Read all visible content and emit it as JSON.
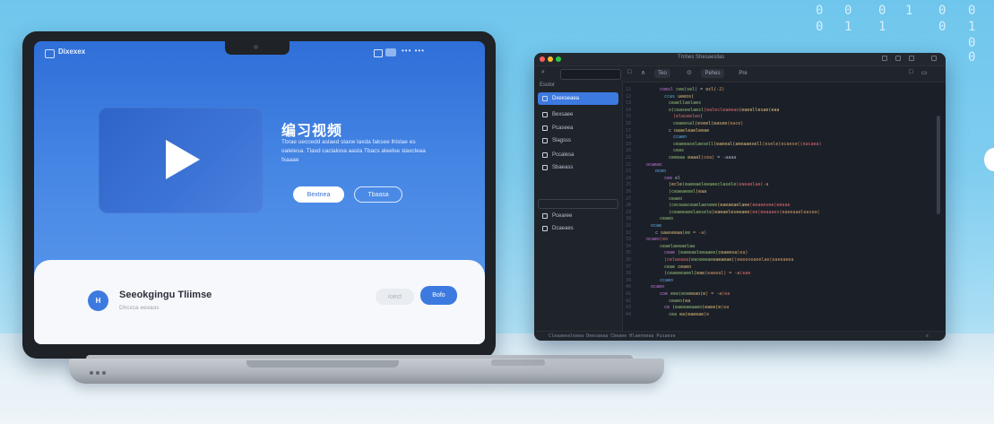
{
  "binary_digits": [
    "0",
    "0",
    "0",
    "1",
    "0",
    "0",
    "0",
    "1",
    "1",
    "0",
    "1",
    "0",
    "0"
  ],
  "laptop": {
    "brand": "Dixexex",
    "topbar_dots": "••• •••",
    "hero": {
      "title": "编习视频",
      "description": "Tbrae ueccedd aslaed slaxw laxda faksee lhlslae es oalelesa. Tlaxd caclalooa aasla Tbacs aleelse slaxcleaa fxaaae",
      "btn_primary": "Bextnea",
      "btn_outline": "Tbaasa"
    },
    "bottom": {
      "avatar": "H",
      "title": "Seeokgingu Tliimse",
      "subtitle": "Dhcxca eexaos",
      "btn_light": "Ioect",
      "btn_blue": "Bofo"
    }
  },
  "editor": {
    "title": "Tmhes Shesaesllas",
    "tools": {
      "search_icon": "search-icon",
      "pill1": "Teo",
      "pill2": "Pehes",
      "pill3": "Pre"
    },
    "sidebar": {
      "header": "Esolor",
      "items": [
        {
          "label": "Dxexseaea",
          "icon": "file-icon",
          "active": true
        },
        {
          "label": "Bexsaee",
          "icon": "folder-icon",
          "active": false
        },
        {
          "label": "Pcaseea",
          "icon": "settings-icon",
          "active": false
        },
        {
          "label": "Slagsss",
          "icon": "layers-icon",
          "active": false
        },
        {
          "label": "Pccalesa",
          "icon": "document-icon",
          "active": false
        },
        {
          "label": "Sbaeass",
          "icon": "gear-icon",
          "active": false
        },
        {
          "label": "Pcearee",
          "icon": "box-icon",
          "active": false
        },
        {
          "label": "Dcaeaes",
          "icon": "database-icon",
          "active": false
        }
      ]
    },
    "code_lines": [
      {
        "n": "11",
        "indent": 4,
        "segs": [
          {
            "t": "coesl ",
            "c": "#c678dd"
          },
          {
            "t": "cee(sel",
            "c": "#98c379"
          },
          {
            "t": ") = ",
            "c": "#abb2bf"
          },
          {
            "t": "ocl(",
            "c": "#e5c07b"
          },
          {
            "t": "-2)",
            "c": "#d19a66"
          }
        ]
      },
      {
        "n": "12",
        "indent": 5,
        "segs": [
          {
            "t": "ccas ",
            "c": "#56b6c2"
          },
          {
            "t": "ueeos(",
            "c": "#e5c07b"
          }
        ]
      },
      {
        "n": "13",
        "indent": 6,
        "segs": [
          {
            "t": "ceaellaelaes",
            "c": "#98c379"
          }
        ]
      },
      {
        "n": "14",
        "indent": 6,
        "segs": [
          {
            "t": "o(ceaseelaesl",
            "c": "#98c379"
          },
          {
            "t": "(ealecleaeeao",
            "c": "#e06c75"
          },
          {
            "t": "(eaeellesae(eaa",
            "c": "#e5c07b"
          }
        ]
      },
      {
        "n": "15",
        "indent": 7,
        "segs": [
          {
            "t": "(elaceeleo",
            "c": "#e06c75"
          },
          {
            "t": "(",
            "c": "#abb2bf"
          }
        ]
      },
      {
        "n": "16",
        "indent": 7,
        "segs": [
          {
            "t": "ceaeesal",
            "c": "#98c379"
          },
          {
            "t": "(eseel(easee",
            "c": "#e5c07b"
          },
          {
            "t": "(eace)",
            "c": "#d19a66"
          }
        ]
      },
      {
        "n": "17",
        "indent": 6,
        "segs": [
          {
            "t": "c ",
            "c": "#abb2bf"
          },
          {
            "t": "oaaeleaeleeae",
            "c": "#e5c07b"
          }
        ]
      },
      {
        "n": "18",
        "indent": 7,
        "segs": [
          {
            "t": "ccaen",
            "c": "#61afef"
          }
        ]
      },
      {
        "n": "19",
        "indent": 7,
        "segs": [
          {
            "t": "ceaeeaselaesell",
            "c": "#98c379"
          },
          {
            "t": "(eaeeal(aeeaaesell",
            "c": "#e5c07b"
          },
          {
            "t": "(esele(ecaese(",
            "c": "#d19a66"
          },
          {
            "t": "(eacaea)",
            "c": "#e06c75"
          }
        ]
      },
      {
        "n": "20",
        "indent": 7,
        "segs": [
          {
            "t": "ceas",
            "c": "#98c379"
          }
        ]
      },
      {
        "n": "21",
        "indent": 6,
        "segs": [
          {
            "t": "ceeeaa ",
            "c": "#98c379"
          },
          {
            "t": "eaaal",
            "c": "#e5c07b"
          },
          {
            "t": "(cea) ",
            "c": "#d19a66"
          },
          {
            "t": "= -aaaa",
            "c": "#abb2bf"
          }
        ]
      },
      {
        "n": "22",
        "indent": 1,
        "segs": [
          {
            "t": "ocaeac",
            "c": "#c678dd"
          }
        ]
      },
      {
        "n": "23",
        "indent": 3,
        "segs": [
          {
            "t": "oceo",
            "c": "#61afef"
          }
        ]
      },
      {
        "n": "24",
        "indent": 5,
        "segs": [
          {
            "t": "cee ",
            "c": "#c678dd"
          },
          {
            "t": "el",
            "c": "#abb2bf"
          }
        ]
      },
      {
        "n": "25",
        "indent": 6,
        "segs": [
          {
            "t": "(ecle",
            "c": "#e5c07b"
          },
          {
            "t": "(eaeeaeleeaeeclasele",
            "c": "#98c379"
          },
          {
            "t": "(eaeaelae",
            "c": "#e06c75"
          },
          {
            "t": "(-a",
            "c": "#d19a66"
          }
        ]
      },
      {
        "n": "26",
        "indent": 6,
        "segs": [
          {
            "t": "(ceaeaeeel",
            "c": "#98c379"
          },
          {
            "t": "(eaa",
            "c": "#e5c07b"
          }
        ]
      },
      {
        "n": "27",
        "indent": 6,
        "segs": [
          {
            "t": "ceaeo",
            "c": "#98c379"
          }
        ]
      },
      {
        "n": "28",
        "indent": 6,
        "segs": [
          {
            "t": "(ceceaaceaelaeseee",
            "c": "#98c379"
          },
          {
            "t": "(eaeaeaelaee",
            "c": "#e5c07b"
          },
          {
            "t": "(eeaeesee(eeeae",
            "c": "#e06c75"
          }
        ]
      },
      {
        "n": "29",
        "indent": 6,
        "segs": [
          {
            "t": "(ceaeeaeelaesele",
            "c": "#98c379"
          },
          {
            "t": "(eaeaeleseeaee",
            "c": "#e5c07b"
          },
          {
            "t": "(ee(eeaaaes",
            "c": "#e06c75"
          },
          {
            "t": "(eaeeaaeleasea(",
            "c": "#d19a66"
          }
        ]
      },
      {
        "n": "30",
        "indent": 4,
        "segs": [
          {
            "t": "ceaeo",
            "c": "#98c379"
          }
        ]
      },
      {
        "n": "31",
        "indent": 2,
        "segs": [
          {
            "t": "ocae",
            "c": "#61afef"
          }
        ]
      },
      {
        "n": "32",
        "indent": 3,
        "segs": [
          {
            "t": "c ",
            "c": "#abb2bf"
          },
          {
            "t": "saaseeaa",
            "c": "#e5c07b"
          },
          {
            "t": "(ee",
            "c": "#98c379"
          },
          {
            "t": " = -a)",
            "c": "#d19a66"
          }
        ]
      },
      {
        "n": "33",
        "indent": 1,
        "segs": [
          {
            "t": "ocaeo",
            "c": "#c678dd"
          },
          {
            "t": "(eo",
            "c": "#e06c75"
          }
        ]
      },
      {
        "n": "34",
        "indent": 4,
        "segs": [
          {
            "t": "ceaelaeeaelaa",
            "c": "#98c379"
          }
        ]
      },
      {
        "n": "35",
        "indent": 5,
        "segs": [
          {
            "t": "ceae ",
            "c": "#c678dd"
          },
          {
            "t": "(eaeeaeleeaaee(",
            "c": "#98c379"
          },
          {
            "t": "ceaeesa",
            "c": "#e5c07b"
          },
          {
            "t": "(ea)",
            "c": "#d19a66"
          }
        ]
      },
      {
        "n": "36",
        "indent": 5,
        "segs": [
          {
            "t": "(celeeaea",
            "c": "#e06c75"
          },
          {
            "t": "(eaceeeae",
            "c": "#98c379"
          },
          {
            "t": "eaeaeae(",
            "c": "#e5c07b"
          },
          {
            "t": "(eeeeseaeelae(eaeeaeea",
            "c": "#d19a66"
          }
        ]
      },
      {
        "n": "37",
        "indent": 5,
        "segs": [
          {
            "t": "ceae ",
            "c": "#98c379"
          },
          {
            "t": "ceaeo",
            "c": "#e5c07b"
          }
        ]
      },
      {
        "n": "38",
        "indent": 5,
        "segs": [
          {
            "t": "(ceaeeeaeel",
            "c": "#98c379"
          },
          {
            "t": "(eae",
            "c": "#e5c07b"
          },
          {
            "t": "(eaeeal) = -a",
            "c": "#d19a66"
          },
          {
            "t": "(eae",
            "c": "#e06c75"
          }
        ]
      },
      {
        "n": "39",
        "indent": 4,
        "segs": [
          {
            "t": "ccaeo",
            "c": "#61afef"
          }
        ]
      },
      {
        "n": "40",
        "indent": 2,
        "segs": [
          {
            "t": "ocaeo",
            "c": "#c678dd"
          }
        ]
      },
      {
        "n": "41",
        "indent": 4,
        "segs": [
          {
            "t": "coe ",
            "c": "#c678dd"
          },
          {
            "t": "eee(eoe",
            "c": "#98c379"
          },
          {
            "t": "eeao(e",
            "c": "#e5c07b"
          },
          {
            "t": ") = -a",
            "c": "#d19a66"
          },
          {
            "t": "(ea",
            "c": "#e06c75"
          }
        ]
      },
      {
        "n": "42",
        "indent": 6,
        "segs": [
          {
            "t": "ceaeo",
            "c": "#98c379"
          },
          {
            "t": "(ea",
            "c": "#e5c07b"
          }
        ]
      },
      {
        "n": "43",
        "indent": 5,
        "segs": [
          {
            "t": "ce ",
            "c": "#c678dd"
          },
          {
            "t": "(eaeeaeaaeo",
            "c": "#98c379"
          },
          {
            "t": "(eaee(e",
            "c": "#e5c07b"
          },
          {
            "t": "(ea",
            "c": "#d19a66"
          }
        ]
      },
      {
        "n": "44",
        "indent": 6,
        "segs": [
          {
            "t": "cea ",
            "c": "#98c379"
          },
          {
            "t": "ea(eaeeae",
            "c": "#e5c07b"
          },
          {
            "t": "(e",
            "c": "#d19a66"
          }
        ]
      }
    ],
    "status_left": "Cleaaeealeaea  Deesaeaa  Cbeaee  Hlaeneeaa  Pusaese",
    "status_right": "≡"
  }
}
